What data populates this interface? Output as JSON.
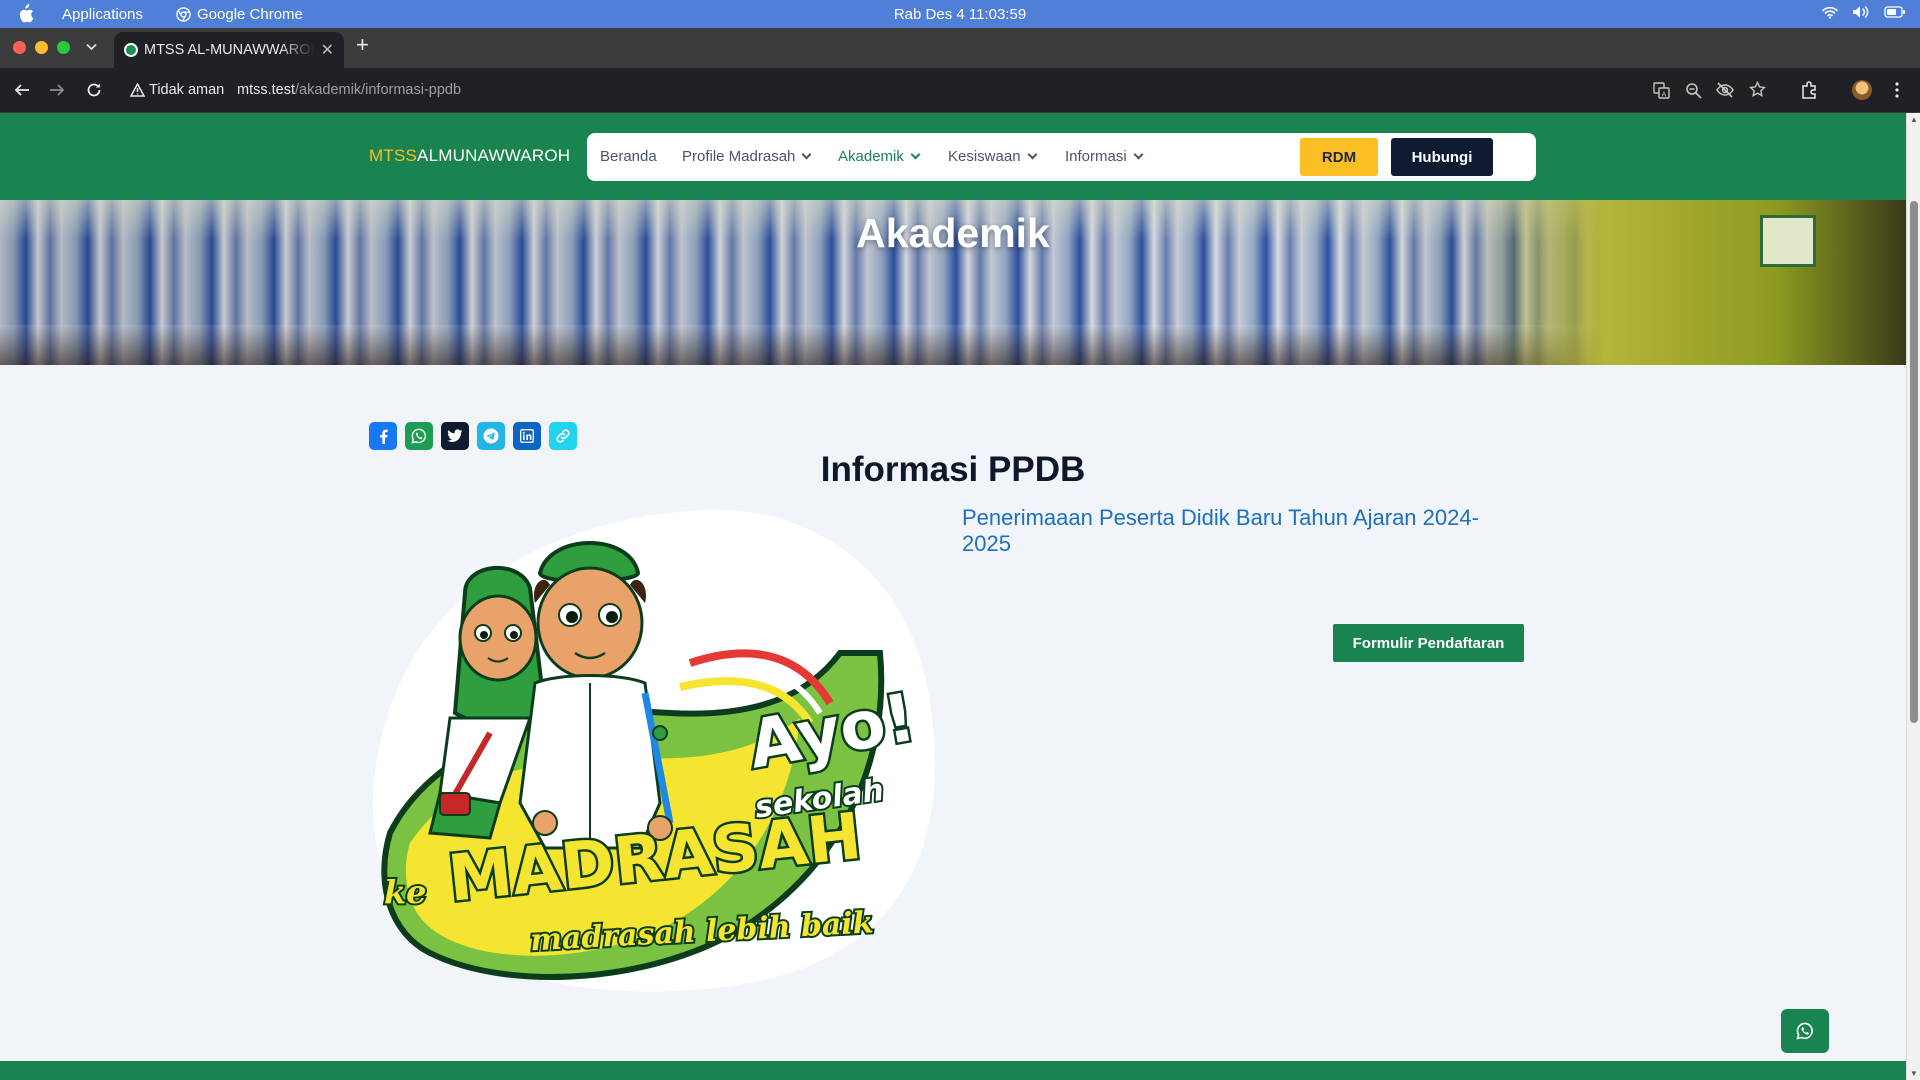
{
  "os_menubar": {
    "app_menu": "Applications",
    "browser_name": "Google Chrome",
    "datetime": "Rab Des 4  11:03:59"
  },
  "browser": {
    "tab_title": "MTSS AL-MUNAWWAROH",
    "security_label": "Tidak aman",
    "url_host": "mtss.test",
    "url_path": "/akademik/informasi-ppdb"
  },
  "site": {
    "brand_part1": "MTSS",
    "brand_part2": "ALMUNAWWAROH",
    "nav": [
      {
        "label": "Beranda"
      },
      {
        "label": "Profile Madrasah"
      },
      {
        "label": "Akademik"
      },
      {
        "label": "Kesiswaan"
      },
      {
        "label": "Informasi"
      }
    ],
    "btn_rdm": "RDM",
    "btn_hubungi": "Hubungi"
  },
  "hero": {
    "title": "Akademik"
  },
  "content": {
    "title": "Informasi PPDB",
    "subtitle": "Penerimaaan Peserta Didik Baru Tahun Ajaran 2024-2025",
    "form_button": "Formulir Pendaftaran",
    "illustration": {
      "text_ayo": "Ayo!",
      "text_sekolah": "sekolah",
      "text_ke": "ke",
      "text_madrasah": "MADRASAH",
      "text_tagline": "madrasah lebih baik"
    }
  },
  "share_icons": [
    "facebook-icon",
    "whatsapp-icon",
    "twitter-icon",
    "telegram-icon",
    "linkedin-icon",
    "link-icon"
  ],
  "colors": {
    "brand_green": "#1a8450",
    "accent_yellow": "#fbbf24",
    "navy": "#0f1b30",
    "link_blue": "#1d6fbf"
  }
}
